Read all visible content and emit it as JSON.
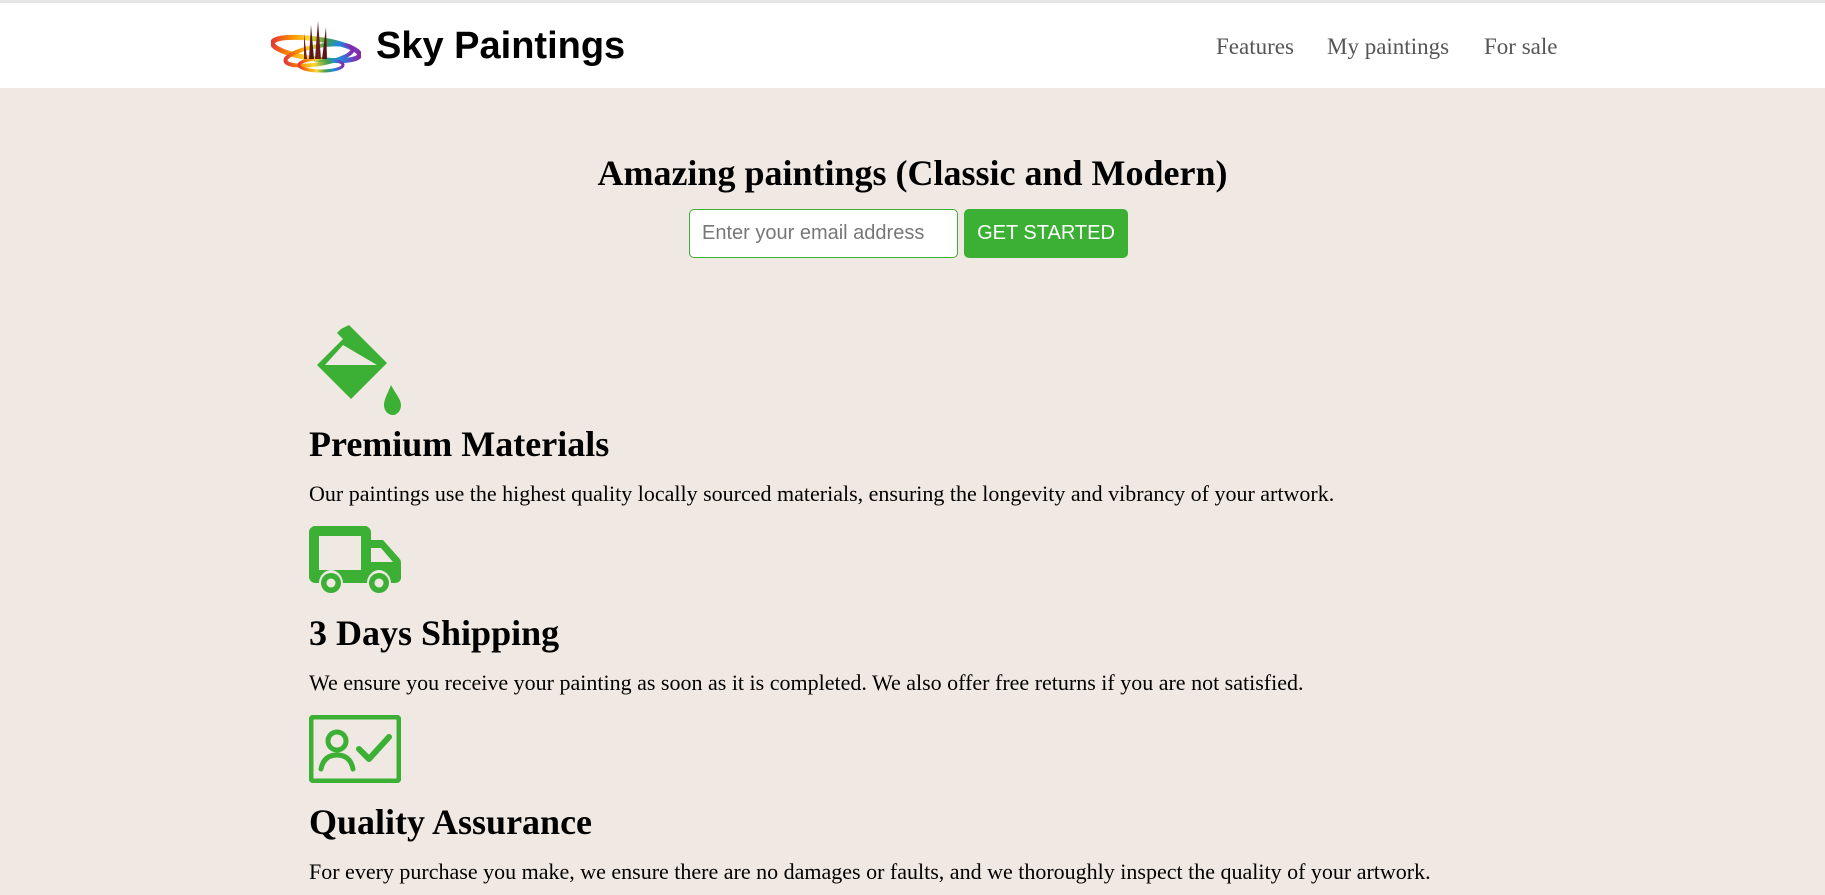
{
  "header": {
    "brand": "Sky Paintings",
    "nav": [
      "Features",
      "My paintings",
      "For sale"
    ]
  },
  "hero": {
    "title": "Amazing paintings (Classic and Modern)",
    "email_placeholder": "Enter your email address",
    "cta_label": "GET STARTED"
  },
  "features": [
    {
      "icon": "paint-bucket-icon",
      "title": "Premium Materials",
      "text": "Our paintings use the highest quality locally sourced materials, ensuring the longevity and vibrancy of your artwork."
    },
    {
      "icon": "truck-icon",
      "title": "3 Days Shipping",
      "text": "We ensure you receive your painting as soon as it is completed. We also offer free returns if you are not satisfied."
    },
    {
      "icon": "id-card-check-icon",
      "title": "Quality Assurance",
      "text": "For every purchase you make, we ensure there are no damages or faults, and we thoroughly inspect the quality of your artwork."
    }
  ],
  "colors": {
    "accent": "#3cb034",
    "background": "#f0e9e3",
    "header_bg": "#ffffff",
    "nav_text": "#555555"
  }
}
